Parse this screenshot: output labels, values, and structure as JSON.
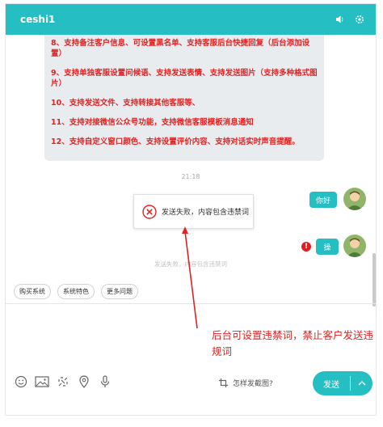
{
  "header": {
    "title": "ceshi1",
    "sound_icon": "speaker-icon",
    "settings_icon": "gear-icon"
  },
  "notice": {
    "items": [
      "8、支持备注客户信息、可设置黑名单、支持客服后台快捷回复（后台添加设置）",
      "9、支持单独客服设置问候语、支持发送表情、支持发送图片（支持多种格式图片）",
      "10、支持发送文件、支持转接其他客服等、",
      "11、支持对接微信公众号功能，支持微信客服模板消息通知",
      "12、支持自定义窗口颜色、支持设置评价内容、支持对话实时声音提醒。"
    ]
  },
  "chat": {
    "time": "21:18",
    "toast_text": "发送失败，内容包含违禁词",
    "messages": [
      {
        "text": "你好",
        "status": "sent"
      },
      {
        "text": "操",
        "status": "failed"
      }
    ],
    "fail_note": "发送失败，内容包含违禁词"
  },
  "quick_replies": [
    "购买系统",
    "系统特色",
    "更多问题"
  ],
  "toolbar": {
    "icons": [
      "emoji-icon",
      "image-icon",
      "file-icon",
      "location-icon",
      "microphone-icon"
    ],
    "howto_label": "怎样发截图?",
    "send_label": "发送"
  },
  "annotation": "后台可设置违禁词，禁止客户发送违规词",
  "colors": {
    "accent": "#25bfc3",
    "alert": "#e12323"
  }
}
